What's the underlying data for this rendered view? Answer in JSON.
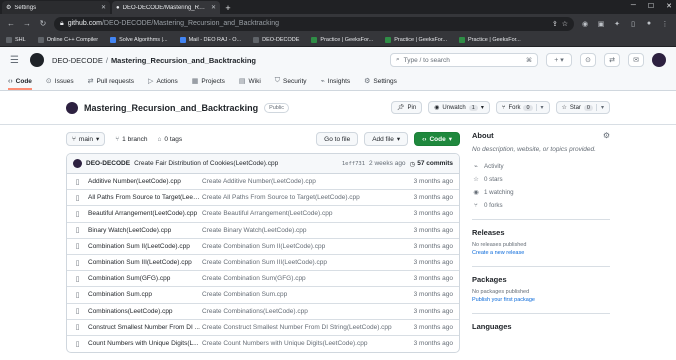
{
  "browser": {
    "tabs": [
      {
        "label": "Settings",
        "active": false
      },
      {
        "label": "DEO-DECODE/Mastering_Recu",
        "active": true
      }
    ],
    "url_host": "github.com",
    "url_path": "/DEO-DECODE/Mastering_Recursion_and_Backtracking",
    "bookmarks": [
      {
        "label": "SHL",
        "color": "#5f6368"
      },
      {
        "label": "Online C++ Compiler",
        "color": "#5f6368"
      },
      {
        "label": "Solve Algorithms |...",
        "color": "#4285f4"
      },
      {
        "label": "Mail - DEO RAJ - O...",
        "color": "#4285f4"
      },
      {
        "label": "DEO-DECODE",
        "color": "#5f6368"
      },
      {
        "label": "Practice | GeeksFor...",
        "color": "#2f8d46"
      },
      {
        "label": "Practice | GeeksFor...",
        "color": "#2f8d46"
      },
      {
        "label": "Practice | GeeksFor...",
        "color": "#2f8d46"
      }
    ]
  },
  "gh": {
    "owner": "DEO-DECODE",
    "repo": "Mastering_Recursion_and_Backtracking",
    "search_placeholder": "Type / to search",
    "nav": [
      {
        "label": "Code",
        "icon": "code-icon",
        "active": true
      },
      {
        "label": "Issues",
        "icon": "issues-icon",
        "active": false
      },
      {
        "label": "Pull requests",
        "icon": "pr-icon",
        "active": false
      },
      {
        "label": "Actions",
        "icon": "actions-icon",
        "active": false
      },
      {
        "label": "Projects",
        "icon": "projects-icon",
        "active": false
      },
      {
        "label": "Wiki",
        "icon": "wiki-icon",
        "active": false
      },
      {
        "label": "Security",
        "icon": "shield-icon",
        "active": false
      },
      {
        "label": "Insights",
        "icon": "insights-icon",
        "active": false
      },
      {
        "label": "Settings",
        "icon": "gear-icon",
        "active": false
      }
    ],
    "visibility": "Public",
    "pin_label": "Pin",
    "unwatch_label": "Unwatch",
    "unwatch_count": "1",
    "fork_label": "Fork",
    "fork_count": "0",
    "star_label": "Star",
    "star_count": "0",
    "branch": "main",
    "branches": "1 branch",
    "tags": "0 tags",
    "goto_file": "Go to file",
    "add_file": "Add file",
    "code_btn": "Code",
    "latest_commit": {
      "author": "DEO-DECODE",
      "message": "Create Fair Distribution of Cookies(LeetCode).cpp",
      "sha": "1eff731",
      "when": "2 weeks ago",
      "commits": "57 commits"
    },
    "files": [
      {
        "name": "Additive Number(LeetCode).cpp",
        "commit": "Create Additive Number(LeetCode).cpp",
        "date": "3 months ago"
      },
      {
        "name": "All Paths From Source to Target(Leet...",
        "commit": "Create All Paths From Source to Target(LeetCode).cpp",
        "date": "3 months ago"
      },
      {
        "name": "Beautiful Arrangement(LeetCode).cpp",
        "commit": "Create Beautiful Arrangement(LeetCode).cpp",
        "date": "3 months ago"
      },
      {
        "name": "Binary Watch(LeetCode).cpp",
        "commit": "Create Binary Watch(LeetCode).cpp",
        "date": "3 months ago"
      },
      {
        "name": "Combination Sum II(LeetCode).cpp",
        "commit": "Create Combination Sum II(LeetCode).cpp",
        "date": "3 months ago"
      },
      {
        "name": "Combination Sum III(LeetCode).cpp",
        "commit": "Create Combination Sum III(LeetCode).cpp",
        "date": "3 months ago"
      },
      {
        "name": "Combination Sum(GFG).cpp",
        "commit": "Create Combination Sum(GFG).cpp",
        "date": "3 months ago"
      },
      {
        "name": "Combination Sum.cpp",
        "commit": "Create Combination Sum.cpp",
        "date": "3 months ago"
      },
      {
        "name": "Combinations(LeetCode).cpp",
        "commit": "Create Combinations(LeetCode).cpp",
        "date": "3 months ago"
      },
      {
        "name": "Construct Smallest Number From DI ...",
        "commit": "Create Construct Smallest Number From DI String(LeetCode).cpp",
        "date": "3 months ago"
      },
      {
        "name": "Count Numbers with Unique Digits(L...",
        "commit": "Create Count Numbers with Unique Digits(LeetCode).cpp",
        "date": "3 months ago"
      }
    ],
    "about": {
      "title": "About",
      "description": "No description, website, or topics provided.",
      "stats": [
        {
          "icon": "pulse-icon",
          "label": "Activity"
        },
        {
          "icon": "star-icon",
          "label": "0 stars"
        },
        {
          "icon": "eye-icon",
          "label": "1 watching"
        },
        {
          "icon": "fork-icon",
          "label": "0 forks"
        }
      ]
    },
    "releases": {
      "title": "Releases",
      "text": "No releases published",
      "link": "Create a new release"
    },
    "packages": {
      "title": "Packages",
      "text": "No packages published",
      "link": "Publish your first package"
    },
    "languages": {
      "title": "Languages"
    }
  }
}
